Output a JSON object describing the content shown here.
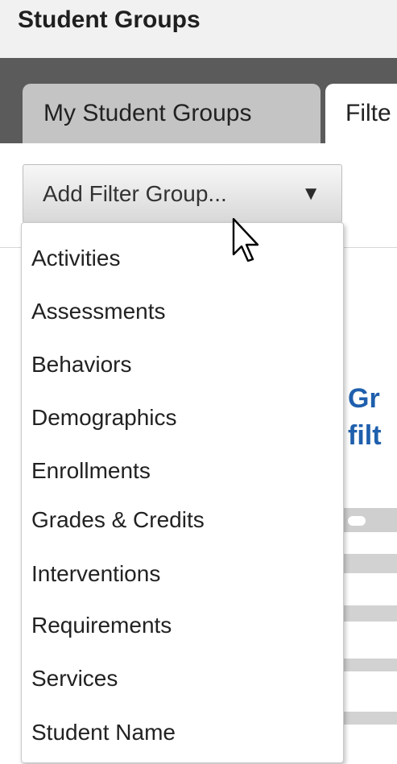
{
  "header": {
    "title": "Student Groups"
  },
  "tabs": [
    {
      "label": "My Student Groups",
      "active": false
    },
    {
      "label": "Filte",
      "active": true
    }
  ],
  "add_filter": {
    "label": "Add Filter Group...",
    "caret_icon": "caret-down-icon"
  },
  "menu": {
    "items": [
      "Activities",
      "Assessments",
      "Behaviors",
      "Demographics",
      "Enrollments",
      "Grades & Credits",
      "Interventions",
      "Requirements",
      "Services",
      "Student Name"
    ]
  },
  "background": {
    "heading_line1": "Gr",
    "heading_line2": "filt"
  },
  "colors": {
    "accent": "#1f5fad",
    "dark_band": "#5b5b5b",
    "tab_inactive": "#c4c4c4"
  }
}
